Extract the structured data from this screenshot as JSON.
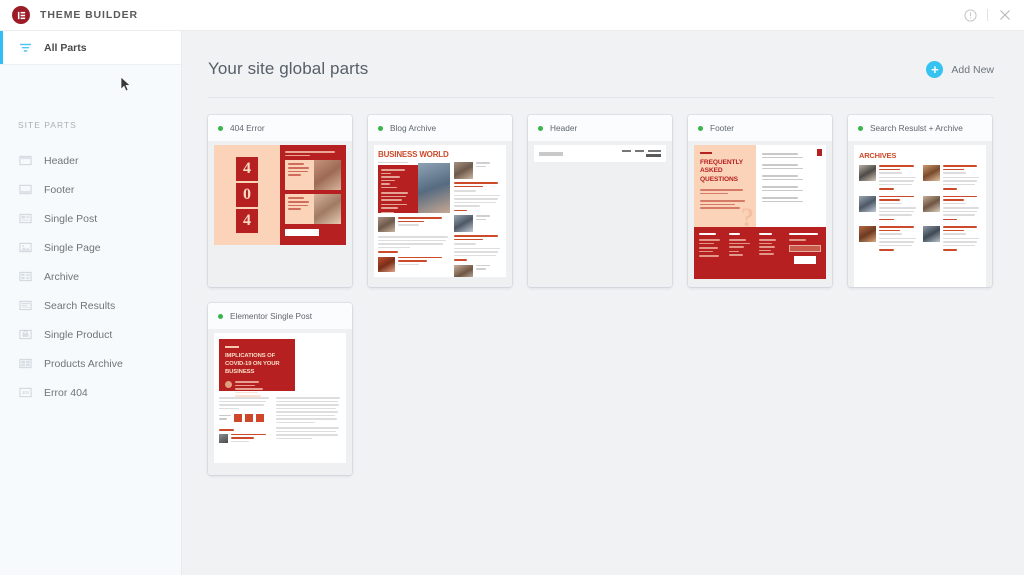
{
  "topbar": {
    "brand": "THEME BUILDER",
    "help_icon": "help-circle-icon",
    "close_icon": "close-icon"
  },
  "sidebar": {
    "active_item": {
      "label": "All Parts",
      "icon": "filter-icon"
    },
    "section_label": "SITE PARTS",
    "items": [
      {
        "label": "Header",
        "icon": "header-layout-icon"
      },
      {
        "label": "Footer",
        "icon": "footer-layout-icon"
      },
      {
        "label": "Single Post",
        "icon": "single-post-icon"
      },
      {
        "label": "Single Page",
        "icon": "single-page-icon"
      },
      {
        "label": "Archive",
        "icon": "archive-icon"
      },
      {
        "label": "Search Results",
        "icon": "search-results-icon"
      },
      {
        "label": "Single Product",
        "icon": "single-product-icon"
      },
      {
        "label": "Products Archive",
        "icon": "products-archive-icon"
      },
      {
        "label": "Error 404",
        "icon": "error-404-icon"
      }
    ]
  },
  "main": {
    "title": "Your site global parts",
    "add_new_label": "Add New",
    "add_new_icon": "plus-circle-icon",
    "cards": [
      {
        "title": "404 Error",
        "status": "published",
        "thumb": "404"
      },
      {
        "title": "Blog Archive",
        "status": "published",
        "thumb": "blog-archive"
      },
      {
        "title": "Header",
        "status": "published",
        "thumb": "header"
      },
      {
        "title": "Footer",
        "status": "published",
        "thumb": "footer"
      },
      {
        "title": "Search Resulst + Archive",
        "status": "published",
        "thumb": "archives"
      },
      {
        "title": "Elementor Single Post",
        "status": "published",
        "thumb": "single-post"
      }
    ]
  },
  "thumbnails": {
    "t404": {
      "digits": [
        "4",
        "0",
        "4"
      ]
    },
    "blog_archive": {
      "heading": "BUSINESS WORLD"
    },
    "footer": {
      "heading": "FREQUENTLY ASKED QUESTIONS",
      "question_mark": "?"
    },
    "archives": {
      "heading": "ARCHIVES"
    },
    "single_post": {
      "heading": "IMPLICATIONS OF COVID-19 ON YOUR BUSINESS"
    }
  },
  "colors": {
    "accent_blue": "#36c3f2",
    "status_green": "#39b54a",
    "brand_maroon": "#9b1c26",
    "theme_red": "#b62020",
    "theme_peach": "#fad3b8",
    "sidebar_bg": "#f7fafc",
    "main_bg": "#f1f2f4"
  }
}
